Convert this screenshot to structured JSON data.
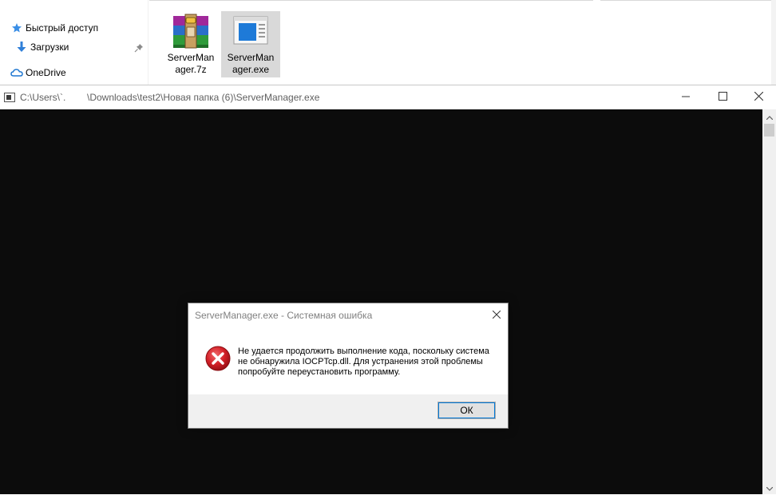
{
  "explorer": {
    "nav": {
      "quick_access": "Быстрый доступ",
      "downloads": "Загрузки",
      "onedrive": "OneDrive"
    },
    "files": [
      {
        "name": "ServerManager.7z",
        "label_line1": "ServerMan",
        "label_line2": "ager.7z",
        "icon": "winrar-archive-icon",
        "selected": false
      },
      {
        "name": "ServerManager.exe",
        "label_line1": "ServerMan",
        "label_line2": "ager.exe",
        "icon": "exe-application-icon",
        "selected": true
      }
    ]
  },
  "console": {
    "title": "C:\\Users\\`.        \\Downloads\\test2\\Новая папка (6)\\ServerManager.exe",
    "buttons": {
      "minimize": "minimize-icon",
      "maximize": "maximize-icon",
      "close": "close-icon"
    }
  },
  "dialog": {
    "title": "ServerManager.exe - Системная ошибка",
    "message": "Не удается продолжить выполнение кода, поскольку система не обнаружила IOCPTcp.dll. Для устранения этой проблемы попробуйте переустановить программу.",
    "ok_label": "ОК",
    "icon": "error-icon"
  },
  "colors": {
    "console_bg": "#0c0c0c",
    "error_red": "#d21f27",
    "selection": "#d9d9d9",
    "focus": "#0078d7"
  }
}
